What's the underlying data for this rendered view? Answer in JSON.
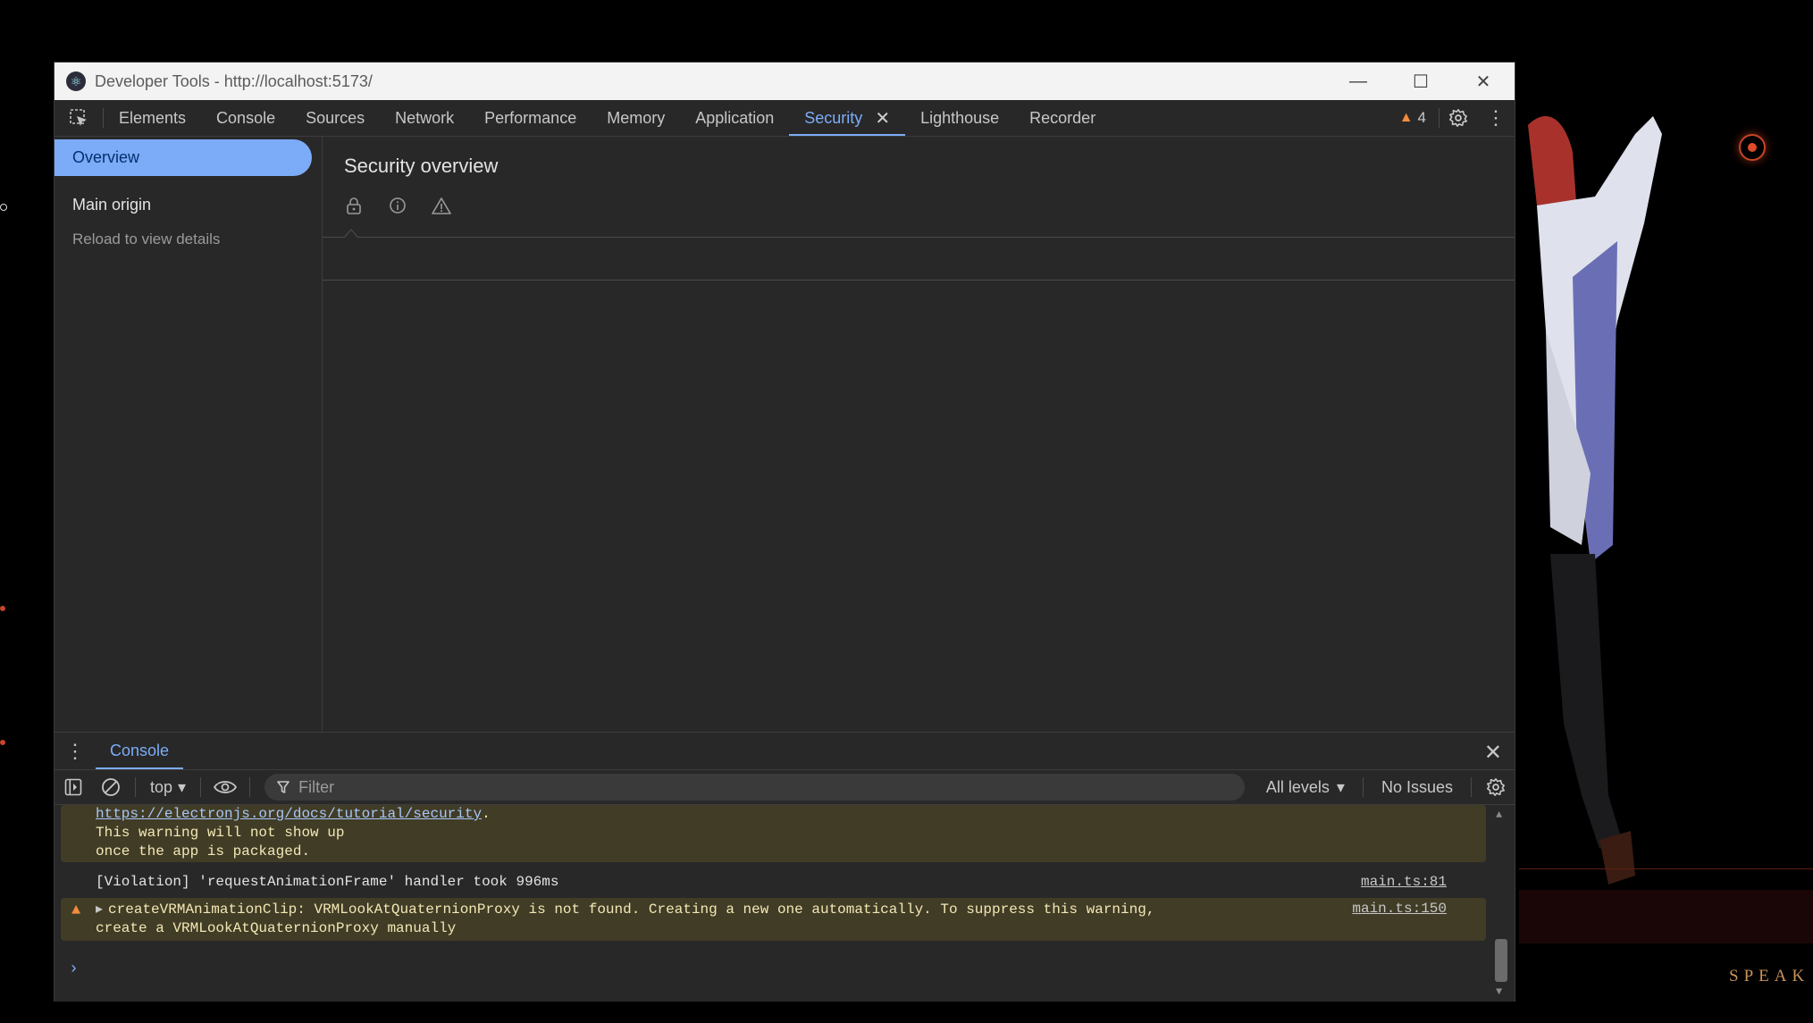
{
  "window": {
    "title": "Developer Tools - http://localhost:5173/",
    "controls": {
      "minimize": "—",
      "maximize": "☐",
      "close": "✕"
    }
  },
  "tabs": [
    {
      "label": "Elements"
    },
    {
      "label": "Console"
    },
    {
      "label": "Sources"
    },
    {
      "label": "Network"
    },
    {
      "label": "Performance"
    },
    {
      "label": "Memory"
    },
    {
      "label": "Application"
    },
    {
      "label": "Security"
    },
    {
      "label": "Lighthouse"
    },
    {
      "label": "Recorder"
    }
  ],
  "active_tab": "Security",
  "issues_count": "4",
  "sidebar": {
    "overview": "Overview",
    "main_origin": "Main origin",
    "reload_hint": "Reload to view details"
  },
  "content": {
    "title": "Security overview"
  },
  "drawer": {
    "tab": "Console",
    "toolbar": {
      "context": "top",
      "filter_placeholder": "Filter",
      "levels": "All levels",
      "issues": "No Issues"
    },
    "messages": {
      "warn1": {
        "link": "https://electronjs.org/docs/tutorial/security",
        "link_suffix": ".",
        "line2": "This warning will not show up",
        "line3": "once the app is packaged."
      },
      "violation": {
        "text": "[Violation] 'requestAnimationFrame' handler took 996ms",
        "source": "main.ts:81"
      },
      "warn2": {
        "line1": "createVRMAnimationClip: VRMLookAtQuaternionProxy is not found. Creating a new one automatically. To suppress this warning,",
        "line2": "create a VRMLookAtQuaternionProxy manually",
        "source": "main.ts:150"
      }
    }
  },
  "background": {
    "speak_label": "SPEAK"
  },
  "colors": {
    "accent": "#7cacf8",
    "warning": "#f28b3c",
    "warn_bg": "#413c26"
  }
}
